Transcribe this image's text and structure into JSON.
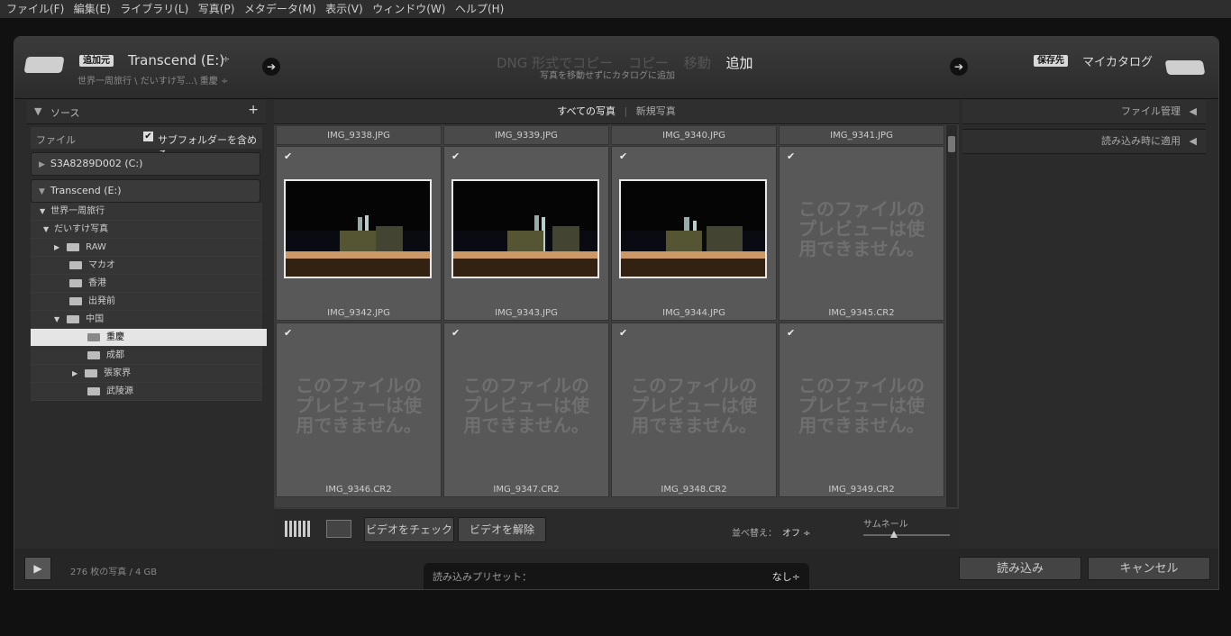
{
  "menu": [
    "ファイル(F)",
    "編集(E)",
    "ライブラリ(L)",
    "写真(P)",
    "メタデータ(M)",
    "表示(V)",
    "ウィンドウ(W)",
    "ヘルプ(H)"
  ],
  "header": {
    "source_badge": "追加元",
    "source_drive": "Transcend (E:)",
    "source_path": "世界一周旅行 \\ だいすけ写...\\ 重慶 ÷",
    "modes": [
      "DNG 形式でコピー",
      "コピー",
      "移動",
      "追加"
    ],
    "mode_subtitle": "写真を移動せずにカタログに追加",
    "dest_badge": "保存先",
    "dest_name": "マイカタログ"
  },
  "left": {
    "title": "ソース",
    "file_label": "ファイル",
    "include_subfolders": "サブフォルダーを含める",
    "drive_c": "S3A8289D002 (C:)",
    "drive_e": "Transcend (E:)",
    "tree": [
      "世界一周旅行",
      "だいすけ写真",
      "RAW",
      "マカオ",
      "香港",
      "出発前",
      "中国",
      "重慶",
      "成都",
      "張家界",
      "武陵源"
    ]
  },
  "center": {
    "tab_all": "すべての写真",
    "tab_new": "新規写真",
    "header_files": [
      "IMG_9338.JPG",
      "IMG_9339.JPG",
      "IMG_9340.JPG",
      "IMG_9341.JPG"
    ],
    "row1_files": [
      "IMG_9342.JPG",
      "IMG_9343.JPG",
      "IMG_9344.JPG",
      "IMG_9345.CR2"
    ],
    "row2_files": [
      "IMG_9346.CR2",
      "IMG_9347.CR2",
      "IMG_9348.CR2",
      "IMG_9349.CR2"
    ],
    "no_preview": "このファイルのプレビューは使用できません。",
    "btn_check_video": "ビデオをチェック",
    "btn_uncheck_video": "ビデオを解除",
    "sort_label": "並べ替え：",
    "sort_value": "オフ ÷",
    "thumb_label": "サムネール"
  },
  "right": {
    "file_handling": "ファイル管理",
    "apply_during_import": "読み込み時に適用"
  },
  "footer": {
    "count": "276 枚の写真 / 4 GB",
    "preset_label": "読み込みプリセット：",
    "preset_value": "なし÷",
    "import": "読み込み",
    "cancel": "キャンセル"
  }
}
